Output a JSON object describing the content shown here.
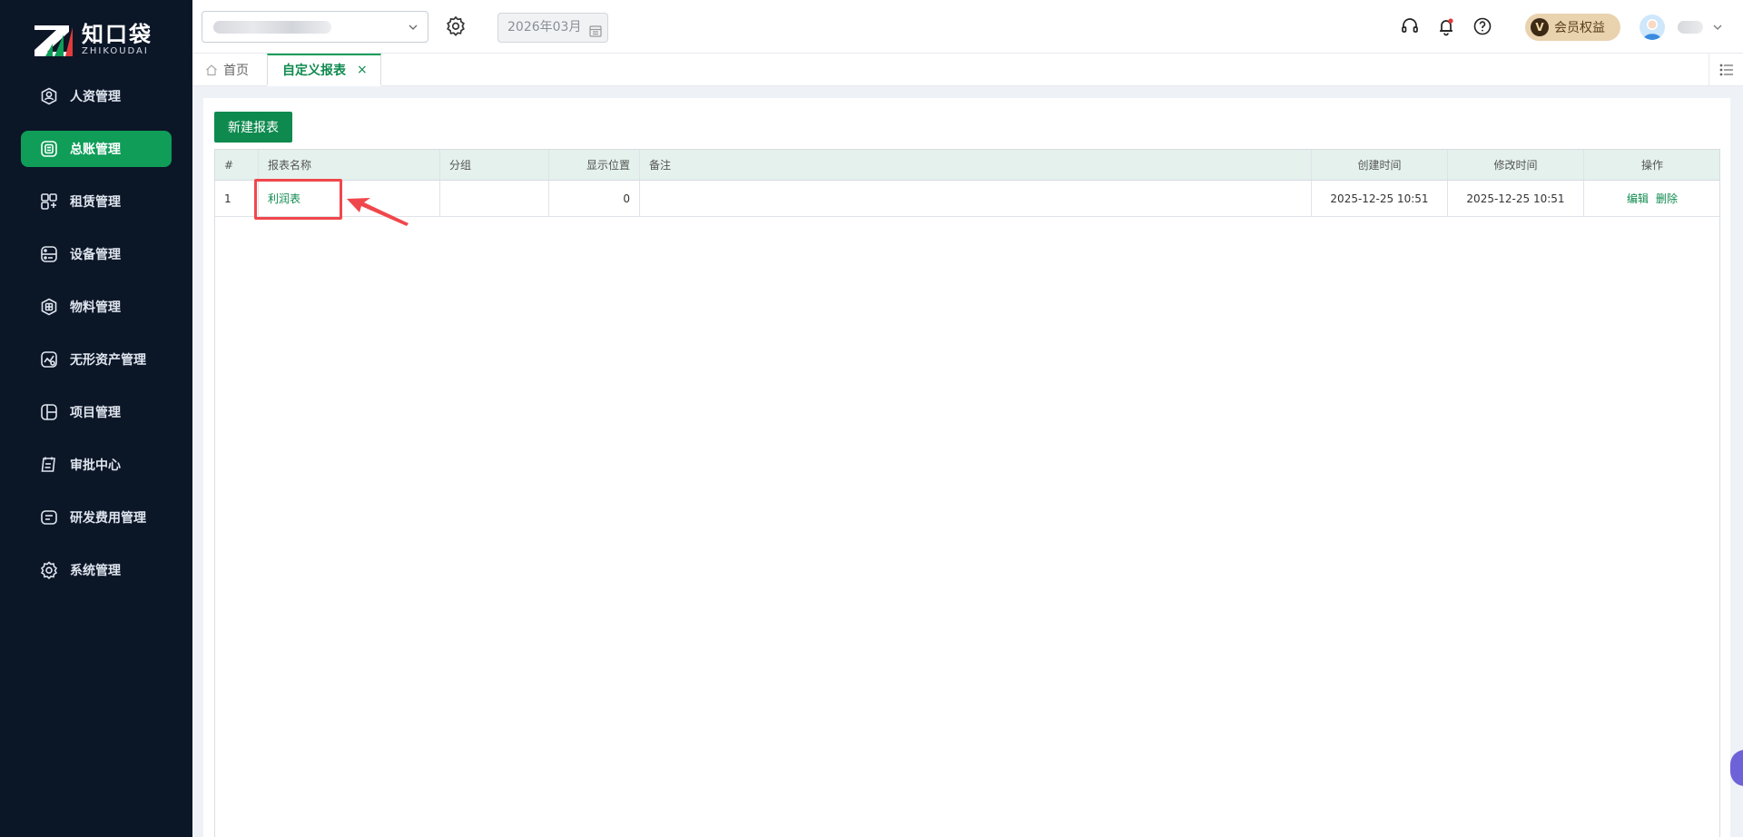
{
  "brand": {
    "name_cn": "知口袋",
    "name_en": "ZHIKOUDAI",
    "accent": "#0f9d58"
  },
  "sidebar": {
    "items": [
      {
        "label": "人资管理",
        "icon": "user-circle-icon",
        "active": false
      },
      {
        "label": "总账管理",
        "icon": "ledger-icon",
        "active": true
      },
      {
        "label": "租赁管理",
        "icon": "lease-icon",
        "active": false
      },
      {
        "label": "设备管理",
        "icon": "device-icon",
        "active": false
      },
      {
        "label": "物料管理",
        "icon": "material-icon",
        "active": false
      },
      {
        "label": "无形资产管理",
        "icon": "intangible-asset-icon",
        "active": false
      },
      {
        "label": "项目管理",
        "icon": "project-icon",
        "active": false
      },
      {
        "label": "审批中心",
        "icon": "approval-icon",
        "active": false
      },
      {
        "label": "研发费用管理",
        "icon": "rd-expense-icon",
        "active": false
      },
      {
        "label": "系统管理",
        "icon": "gear-icon",
        "active": false
      }
    ]
  },
  "header": {
    "period": "2026年03月",
    "vip_badge": "V",
    "vip_label": "会员权益"
  },
  "tabs": {
    "home_label": "首页",
    "active_label": "自定义报表",
    "close_glyph": "×"
  },
  "toolbar": {
    "new_report_label": "新建报表"
  },
  "table": {
    "columns": [
      "#",
      "报表名称",
      "分组",
      "显示位置",
      "备注",
      "创建时间",
      "修改时间",
      "操作"
    ],
    "rows": [
      {
        "num": "1",
        "name": "利润表",
        "group": "",
        "position": "0",
        "note": "",
        "created": "2025-12-25 10:51",
        "modified": "2025-12-25 10:51",
        "edit_label": "编辑",
        "delete_label": "删除"
      }
    ]
  }
}
